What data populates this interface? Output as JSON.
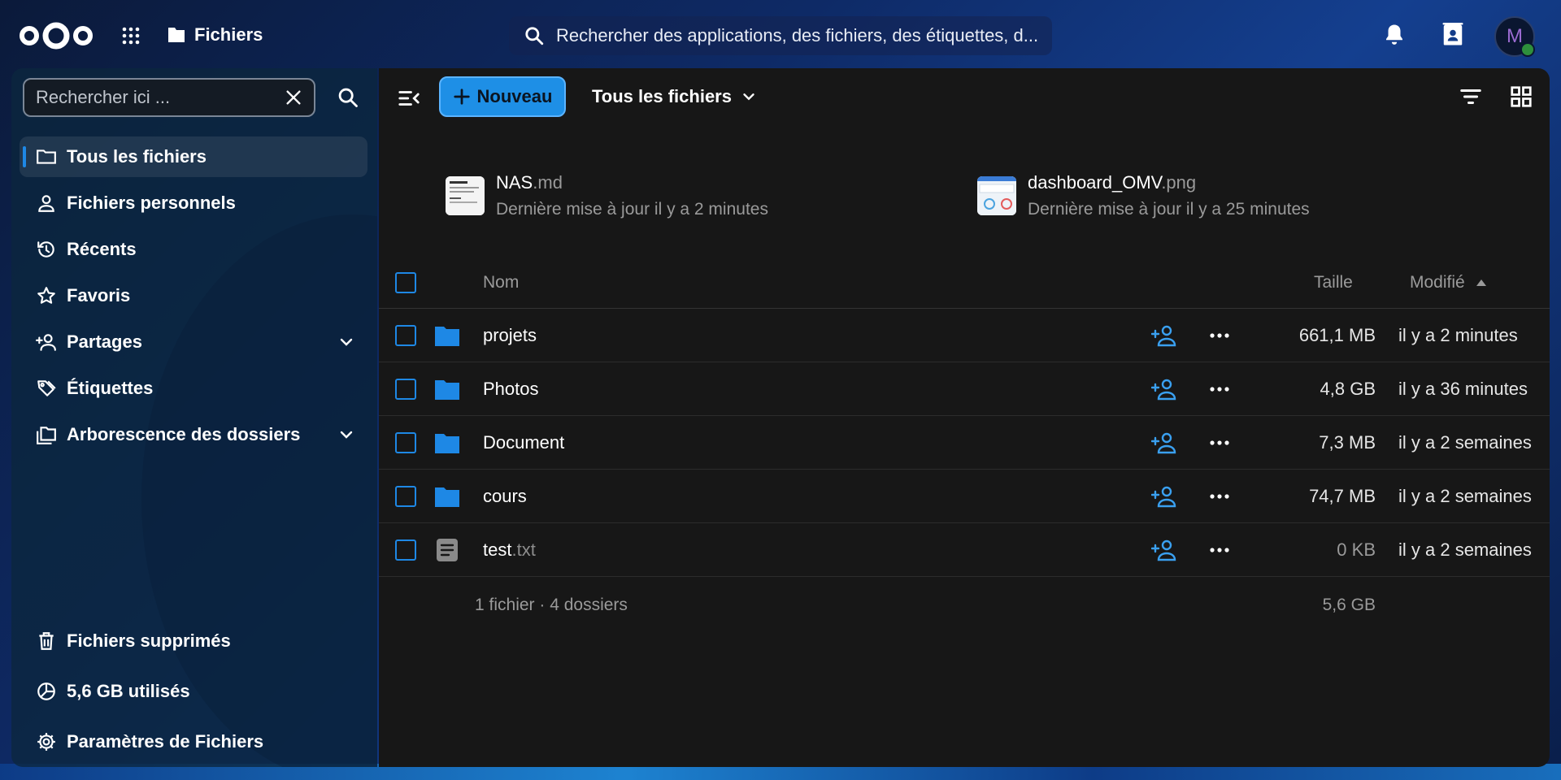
{
  "header": {
    "app_title": "Fichiers",
    "search_text": "Rechercher des applications, des fichiers, des étiquettes, d...",
    "avatar_initial": "M"
  },
  "sidebar": {
    "search_placeholder": "Rechercher ici ...",
    "items": [
      {
        "label": "Tous les fichiers",
        "icon": "folder-icon"
      },
      {
        "label": "Fichiers personnels",
        "icon": "person-icon"
      },
      {
        "label": "Récents",
        "icon": "history-icon"
      },
      {
        "label": "Favoris",
        "icon": "star-icon"
      },
      {
        "label": "Partages",
        "icon": "share-icon"
      },
      {
        "label": "Étiquettes",
        "icon": "tag-icon"
      },
      {
        "label": "Arborescence des dossiers",
        "icon": "folder-tree-icon"
      }
    ],
    "bottom": [
      {
        "label": "Fichiers supprimés",
        "icon": "trash-icon"
      },
      {
        "label": "5,6 GB utilisés",
        "icon": "pie-chart-icon"
      },
      {
        "label": "Paramètres de Fichiers",
        "icon": "gear-icon"
      }
    ]
  },
  "toolbar": {
    "new_label": "Nouveau",
    "breadcrumb": "Tous les fichiers"
  },
  "recent": [
    {
      "name": "NAS",
      "ext": ".md",
      "subtitle": "Dernière mise à jour il y a 2 minutes"
    },
    {
      "name": "dashboard_OMV",
      "ext": ".png",
      "subtitle": "Dernière mise à jour il y a 25 minutes"
    }
  ],
  "table": {
    "col_name": "Nom",
    "col_size": "Taille",
    "col_modified": "Modifié",
    "rows": [
      {
        "name": "projets",
        "ext": "",
        "type": "folder",
        "size": "661,1 MB",
        "modified": "il y a 2 minutes"
      },
      {
        "name": "Photos",
        "ext": "",
        "type": "folder",
        "size": "4,8 GB",
        "modified": "il y a 36 minutes"
      },
      {
        "name": "Document",
        "ext": "",
        "type": "folder",
        "size": "7,3 MB",
        "modified": "il y a 2 semaines"
      },
      {
        "name": "cours",
        "ext": "",
        "type": "folder",
        "size": "74,7 MB",
        "modified": "il y a 2 semaines"
      },
      {
        "name": "test",
        "ext": ".txt",
        "type": "text",
        "size": "0 KB",
        "modified": "il y a 2 semaines"
      }
    ],
    "summary_count": "1 fichier · 4 dossiers",
    "summary_size": "5,6 GB"
  },
  "colors": {
    "accent": "#1e8fe6",
    "main_bg": "#171717"
  }
}
